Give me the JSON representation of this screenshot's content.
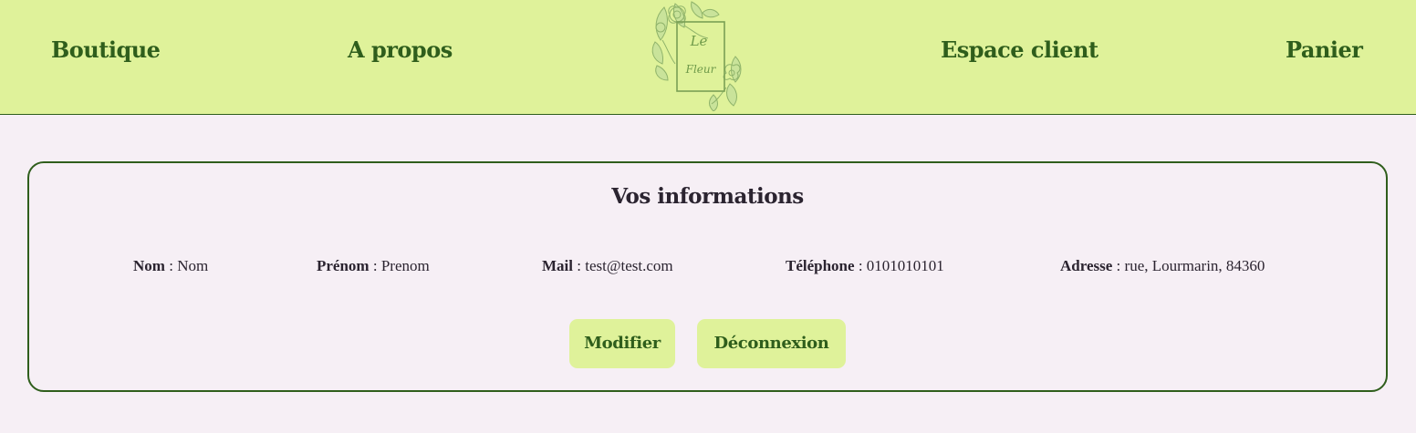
{
  "nav": {
    "boutique": "Boutique",
    "apropos": "A propos",
    "espace_client": "Espace client",
    "panier": "Panier"
  },
  "logo": {
    "text_line1": "Le",
    "text_line2": "Fleur"
  },
  "profile": {
    "title": "Vos informations",
    "fields": [
      {
        "label": "Nom",
        "sep": " : ",
        "value": "Nom"
      },
      {
        "label": "Prénom",
        "sep": " : ",
        "value": "Prenom"
      },
      {
        "label": "Mail",
        "sep": " : ",
        "value": "test@test.com"
      },
      {
        "label": "Téléphone",
        "sep": " : ",
        "value": "0101010101"
      },
      {
        "label": "Adresse",
        "sep": " : ",
        "value": "rue, Lourmarin, 84360"
      }
    ],
    "buttons": {
      "modify": "Modifier",
      "logout": "Déconnexion"
    }
  },
  "colors": {
    "header_bg": "#dff29a",
    "accent_green": "#2f5e1c",
    "page_bg": "#f6eff5",
    "text_dark": "#2b2430"
  }
}
